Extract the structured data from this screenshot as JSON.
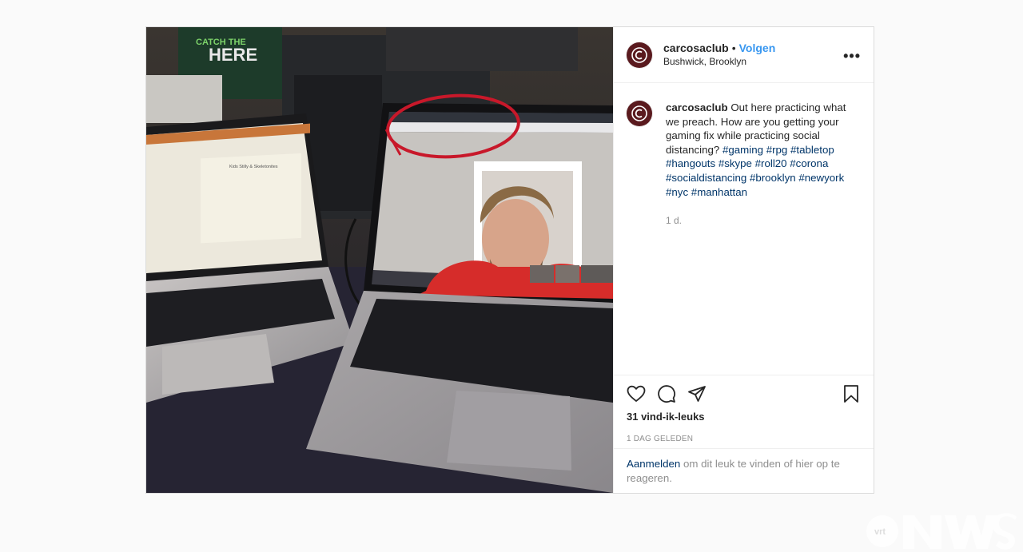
{
  "post": {
    "username": "carcosaclub",
    "follow_label": "Volgen",
    "location": "Bushwick, Brooklyn",
    "more_label": "•••",
    "caption_username": "carcosaclub",
    "caption_text": "Out here practicing what we preach. How are you getting your gaming fix while practicing social distancing?",
    "hashtags": [
      "#gaming",
      "#rpg",
      "#tabletop",
      "#hangouts",
      "#skype",
      "#roll20",
      "#corona",
      "#socialdistancing",
      "#brooklyn",
      "#newyork",
      "#nyc",
      "#manhattan"
    ],
    "time_ago": "1 d.",
    "likes": "31 vind-ik-leuks",
    "date": "1 DAG GELEDEN",
    "login_link": "Aanmelden",
    "login_text": "om dit leuk te vinden of hier op te reageren."
  },
  "photo": {
    "poster_text": "CATCH THE",
    "poster_text2": "HERE",
    "doc_title": "Kids Stilly & Skeletonites"
  },
  "icons": {
    "heart": "heart-icon",
    "comment": "comment-icon",
    "share": "share-icon",
    "bookmark": "bookmark-icon",
    "more": "more-icon"
  },
  "colors": {
    "follow": "#3897f0",
    "hashtag": "#003569",
    "avatar": "#5a1a1e",
    "circle_annotation": "#c8182a"
  }
}
